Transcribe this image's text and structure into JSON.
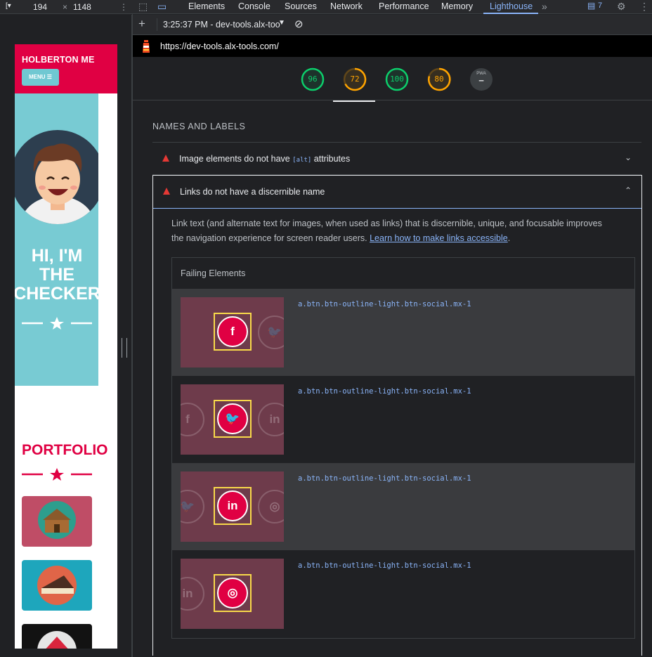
{
  "device_toolbar": {
    "width": "194",
    "height": "1148",
    "times": "×"
  },
  "devtools_tabs": [
    {
      "label": "Elements"
    },
    {
      "label": "Console"
    },
    {
      "label": "Sources"
    },
    {
      "label": "Network"
    },
    {
      "label": "Performance"
    },
    {
      "label": "Memory"
    },
    {
      "label": "Lighthouse",
      "active": true
    }
  ],
  "issues_count": "7",
  "lighthouse_toolbar": {
    "report_select": "3:25:37 PM - dev-tools.alx-too"
  },
  "url_bar": {
    "url": "https://dev-tools.alx-tools.com/"
  },
  "scores": [
    {
      "value": "96",
      "color": "#0cce6b"
    },
    {
      "value": "72",
      "color": "#ffa400"
    },
    {
      "value": "100",
      "color": "#0cce6b"
    },
    {
      "value": "80",
      "color": "#ffa400"
    },
    {
      "value": "—",
      "label": "PWA",
      "color": "#9aa0a6"
    }
  ],
  "site": {
    "brand": "HOLBERTON ME",
    "menu": "MENU ☰",
    "hero_title_lines": [
      "HI, I'M",
      "THE",
      "CHECKER"
    ],
    "portfolio_title": "PORTFOLIO"
  },
  "section": {
    "title": "NAMES AND LABELS",
    "audits": [
      {
        "title_pre": "Image elements do not have ",
        "code": "[alt]",
        "title_post": " attributes",
        "expanded": false
      },
      {
        "title": "Links do not have a discernible name",
        "expanded": true
      }
    ],
    "description": "Link text (and alternate text for images, when used as links) that is discernible, unique, and focusable improves the navigation experience for screen reader users. ",
    "learn_link": "Learn how to make links accessible",
    "description_end": ".",
    "failing_header": "Failing Elements",
    "failing_rows": [
      {
        "selector": "a.btn.btn-outline-light.btn-social.mx-1",
        "icon": "facebook-icon",
        "glyph": "f"
      },
      {
        "selector": "a.btn.btn-outline-light.btn-social.mx-1",
        "icon": "twitter-icon",
        "glyph": "🐦"
      },
      {
        "selector": "a.btn.btn-outline-light.btn-social.mx-1",
        "icon": "linkedin-icon",
        "glyph": "in"
      },
      {
        "selector": "a.btn.btn-outline-light.btn-social.mx-1",
        "icon": "dribbble-icon",
        "glyph": "◎"
      }
    ]
  },
  "colors": {
    "accent": "#e00043",
    "teal": "#78cbd3",
    "link": "#8ab4f8",
    "fail": "#e53935"
  }
}
